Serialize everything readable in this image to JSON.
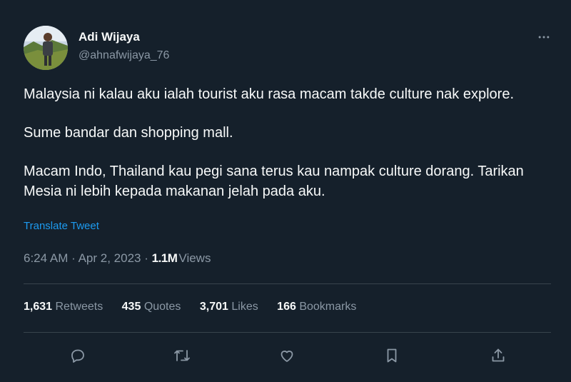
{
  "author": {
    "name": "Adi Wijaya",
    "handle": "@ahnafwijaya_76"
  },
  "tweet": {
    "paragraphs": [
      "Malaysia ni kalau aku ialah tourist aku rasa macam takde culture nak explore.",
      "Sume bandar dan shopping mall.",
      "Macam Indo, Thailand kau pegi sana terus kau nampak culture dorang. Tarikan Mesia ni lebih kepada makanan jelah pada aku."
    ],
    "translate_label": "Translate Tweet"
  },
  "meta": {
    "time": "6:24 AM",
    "date": "Apr 2, 2023",
    "separator": "·",
    "views_count": "1.1M",
    "views_label": "Views"
  },
  "stats": [
    {
      "count": "1,631",
      "label": "Retweets"
    },
    {
      "count": "435",
      "label": "Quotes"
    },
    {
      "count": "3,701",
      "label": "Likes"
    },
    {
      "count": "166",
      "label": "Bookmarks"
    }
  ],
  "actions": [
    "reply-icon",
    "retweet-icon",
    "like-icon",
    "bookmark-icon",
    "share-icon"
  ],
  "colors": {
    "background": "#15202b",
    "text": "#f7f9f9",
    "secondary": "#8b98a5",
    "link": "#1d9bf0",
    "divider": "#38444d"
  }
}
